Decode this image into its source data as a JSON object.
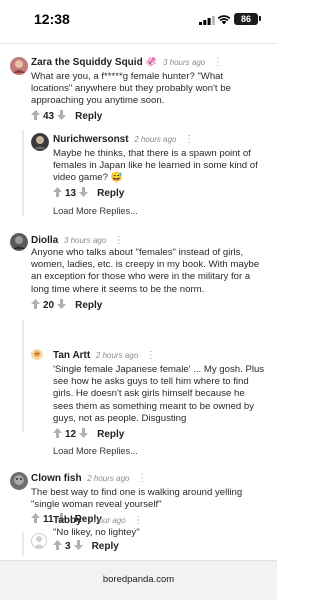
{
  "status_bar": {
    "time": "12:38",
    "battery": "86"
  },
  "comments": [
    {
      "author": "Zara the Squiddy Squid",
      "emoji": "🦑",
      "time": "3 hours ago",
      "lines": [
        "What are you, a f*****g female hunter? \"What",
        "locations\" anywhere but they probably won't be",
        "approaching you anytime soon."
      ],
      "votes": "43",
      "reply_label": "Reply"
    },
    {
      "author": "Nurichwersonst",
      "time": "2 hours ago",
      "lines": [
        "Maybe he thinks, that there is a spawn point of",
        "females in Japan like he learned in some kind of",
        "video game? 😅"
      ],
      "votes": "13",
      "reply_label": "Reply",
      "load_more": "Load More Replies..."
    },
    {
      "author": "Diolla",
      "time": "3 hours ago",
      "lines": [
        "Anyone who talks about \"females\" instead of girls,",
        "women, ladies, etc. is creepy in my book. With maybe",
        "an exception for those who were in the military for a",
        "long time where it seems to be the norm."
      ],
      "votes": "20",
      "reply_label": "Reply"
    },
    {
      "author": "Tan Artt",
      "time": "2 hours ago",
      "lines": [
        "'Single female Japanese female' ... My gosh. Plus",
        "see how he asks guys to tell him where to find",
        "girls. He doesn't ask girls himself because he",
        "sees them as something meant to be owned by",
        "guys, not as people. Disgusting"
      ],
      "votes": "12",
      "reply_label": "Reply",
      "load_more": "Load More Replies..."
    },
    {
      "author": "Clown fish",
      "time": "2 hours ago",
      "lines": [
        "The best way to find one is walking around yelling",
        "\"single woman reveal yourself\""
      ],
      "votes": "11",
      "reply_label": "Reply"
    },
    {
      "author": "Tabby",
      "time": "1 hour ago",
      "lines": [
        "\"No likey, no lightey\""
      ],
      "votes": "3",
      "reply_label": "Reply"
    }
  ],
  "footer": {
    "url": "boredpanda.com"
  },
  "colors": {
    "up_arrow": "#b0b0b0",
    "down_arrow": "#b0b0b0",
    "footer_bg": "#f2f2f2"
  }
}
